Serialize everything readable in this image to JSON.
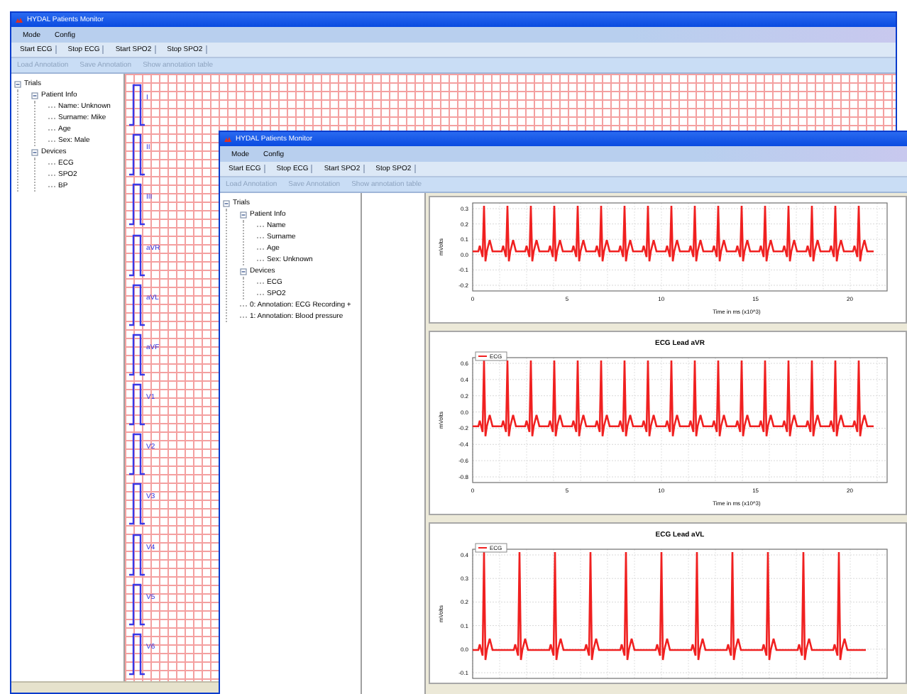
{
  "outer_window": {
    "title": "HYDAL Patients Monitor",
    "menu": [
      "Mode",
      "Config"
    ],
    "toolbar": [
      "Start ECG",
      "Stop ECG",
      "Start SPO2",
      "Stop SPO2"
    ],
    "annotation_toolbar": [
      {
        "label": "Load Annotation",
        "disabled": true
      },
      {
        "label": "Save Annotation",
        "disabled": true
      },
      {
        "label": "Show annotation table",
        "disabled": true
      }
    ],
    "tree": [
      {
        "label": "Trials",
        "expanded": true,
        "children": [
          {
            "label": "Patient Info",
            "expanded": true,
            "children": [
              {
                "label": "Name: Unknown"
              },
              {
                "label": "Surname: Mike"
              },
              {
                "label": "Age"
              },
              {
                "label": "Sex: Male"
              }
            ]
          },
          {
            "label": "Devices",
            "expanded": true,
            "children": [
              {
                "label": "ECG"
              },
              {
                "label": "SPO2"
              },
              {
                "label": "BP"
              }
            ]
          }
        ]
      }
    ],
    "leads": [
      "I",
      "II",
      "III",
      "aVR",
      "aVL",
      "aVF",
      "V1",
      "V2",
      "V3",
      "V4",
      "V5",
      "V6"
    ]
  },
  "inner_window": {
    "title": "HYDAL Patients Monitor",
    "menu": [
      "Mode",
      "Config"
    ],
    "toolbar": [
      "Start ECG",
      "Stop ECG",
      "Start SPO2",
      "Stop SPO2"
    ],
    "annotation_toolbar": [
      {
        "label": "Load Annotation",
        "disabled": true
      },
      {
        "label": "Save Annotation",
        "disabled": true
      },
      {
        "label": "Show annotation table",
        "disabled": true
      }
    ],
    "tree": [
      {
        "label": "Trials",
        "expanded": true,
        "children": [
          {
            "label": "Patient Info",
            "expanded": true,
            "children": [
              {
                "label": "Name"
              },
              {
                "label": "Surname"
              },
              {
                "label": "Age"
              },
              {
                "label": "Sex: Unknown"
              }
            ]
          },
          {
            "label": "Devices",
            "expanded": true,
            "children": [
              {
                "label": "ECG"
              },
              {
                "label": "SPO2"
              }
            ]
          },
          {
            "label": "0: Annotation: ECG Recording +"
          },
          {
            "label": "1: Annotation: Blood pressure"
          }
        ]
      }
    ],
    "charts": [
      {
        "ylabel": "mVolts",
        "yticks": [
          "0.3",
          "0.2",
          "0.1",
          "0.0",
          "-0.1",
          "-0.2"
        ],
        "xticks": [
          "0",
          "5",
          "10",
          "15",
          "20"
        ],
        "xlabel": "Time in ms (x10^3)"
      },
      {
        "title": "ECG Lead aVR",
        "legend": "ECG",
        "ylabel": "mVolts",
        "yticks": [
          "0.6",
          "0.4",
          "0.2",
          "0.0",
          "-0.2",
          "-0.4",
          "-0.6",
          "-0.8"
        ],
        "xticks": [
          "0",
          "5",
          "10",
          "15",
          "20"
        ],
        "xlabel": "Time in ms (x10^3)"
      },
      {
        "title": "ECG Lead aVL",
        "legend": "ECG",
        "ylabel": "mVolts",
        "yticks": [
          "0.4",
          "0.3",
          "0.2",
          "0.1",
          "0.0",
          "-0.1"
        ]
      }
    ]
  }
}
